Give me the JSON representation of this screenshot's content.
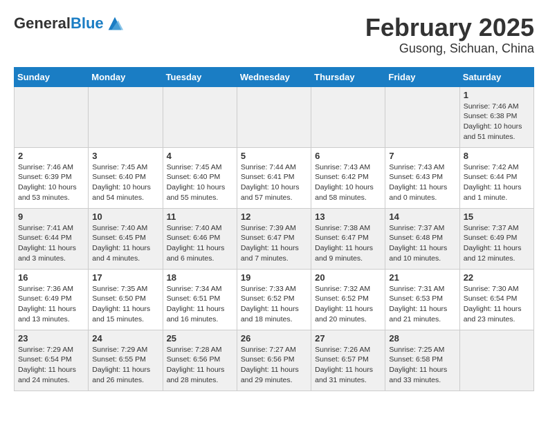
{
  "header": {
    "logo_general": "General",
    "logo_blue": "Blue",
    "title": "February 2025",
    "subtitle": "Gusong, Sichuan, China"
  },
  "days_of_week": [
    "Sunday",
    "Monday",
    "Tuesday",
    "Wednesday",
    "Thursday",
    "Friday",
    "Saturday"
  ],
  "weeks": [
    [
      {
        "day": "",
        "info": ""
      },
      {
        "day": "",
        "info": ""
      },
      {
        "day": "",
        "info": ""
      },
      {
        "day": "",
        "info": ""
      },
      {
        "day": "",
        "info": ""
      },
      {
        "day": "",
        "info": ""
      },
      {
        "day": "1",
        "info": "Sunrise: 7:46 AM\nSunset: 6:38 PM\nDaylight: 10 hours\nand 51 minutes."
      }
    ],
    [
      {
        "day": "2",
        "info": "Sunrise: 7:46 AM\nSunset: 6:39 PM\nDaylight: 10 hours\nand 53 minutes."
      },
      {
        "day": "3",
        "info": "Sunrise: 7:45 AM\nSunset: 6:40 PM\nDaylight: 10 hours\nand 54 minutes."
      },
      {
        "day": "4",
        "info": "Sunrise: 7:45 AM\nSunset: 6:40 PM\nDaylight: 10 hours\nand 55 minutes."
      },
      {
        "day": "5",
        "info": "Sunrise: 7:44 AM\nSunset: 6:41 PM\nDaylight: 10 hours\nand 57 minutes."
      },
      {
        "day": "6",
        "info": "Sunrise: 7:43 AM\nSunset: 6:42 PM\nDaylight: 10 hours\nand 58 minutes."
      },
      {
        "day": "7",
        "info": "Sunrise: 7:43 AM\nSunset: 6:43 PM\nDaylight: 11 hours\nand 0 minutes."
      },
      {
        "day": "8",
        "info": "Sunrise: 7:42 AM\nSunset: 6:44 PM\nDaylight: 11 hours\nand 1 minute."
      }
    ],
    [
      {
        "day": "9",
        "info": "Sunrise: 7:41 AM\nSunset: 6:44 PM\nDaylight: 11 hours\nand 3 minutes."
      },
      {
        "day": "10",
        "info": "Sunrise: 7:40 AM\nSunset: 6:45 PM\nDaylight: 11 hours\nand 4 minutes."
      },
      {
        "day": "11",
        "info": "Sunrise: 7:40 AM\nSunset: 6:46 PM\nDaylight: 11 hours\nand 6 minutes."
      },
      {
        "day": "12",
        "info": "Sunrise: 7:39 AM\nSunset: 6:47 PM\nDaylight: 11 hours\nand 7 minutes."
      },
      {
        "day": "13",
        "info": "Sunrise: 7:38 AM\nSunset: 6:47 PM\nDaylight: 11 hours\nand 9 minutes."
      },
      {
        "day": "14",
        "info": "Sunrise: 7:37 AM\nSunset: 6:48 PM\nDaylight: 11 hours\nand 10 minutes."
      },
      {
        "day": "15",
        "info": "Sunrise: 7:37 AM\nSunset: 6:49 PM\nDaylight: 11 hours\nand 12 minutes."
      }
    ],
    [
      {
        "day": "16",
        "info": "Sunrise: 7:36 AM\nSunset: 6:49 PM\nDaylight: 11 hours\nand 13 minutes."
      },
      {
        "day": "17",
        "info": "Sunrise: 7:35 AM\nSunset: 6:50 PM\nDaylight: 11 hours\nand 15 minutes."
      },
      {
        "day": "18",
        "info": "Sunrise: 7:34 AM\nSunset: 6:51 PM\nDaylight: 11 hours\nand 16 minutes."
      },
      {
        "day": "19",
        "info": "Sunrise: 7:33 AM\nSunset: 6:52 PM\nDaylight: 11 hours\nand 18 minutes."
      },
      {
        "day": "20",
        "info": "Sunrise: 7:32 AM\nSunset: 6:52 PM\nDaylight: 11 hours\nand 20 minutes."
      },
      {
        "day": "21",
        "info": "Sunrise: 7:31 AM\nSunset: 6:53 PM\nDaylight: 11 hours\nand 21 minutes."
      },
      {
        "day": "22",
        "info": "Sunrise: 7:30 AM\nSunset: 6:54 PM\nDaylight: 11 hours\nand 23 minutes."
      }
    ],
    [
      {
        "day": "23",
        "info": "Sunrise: 7:29 AM\nSunset: 6:54 PM\nDaylight: 11 hours\nand 24 minutes."
      },
      {
        "day": "24",
        "info": "Sunrise: 7:29 AM\nSunset: 6:55 PM\nDaylight: 11 hours\nand 26 minutes."
      },
      {
        "day": "25",
        "info": "Sunrise: 7:28 AM\nSunset: 6:56 PM\nDaylight: 11 hours\nand 28 minutes."
      },
      {
        "day": "26",
        "info": "Sunrise: 7:27 AM\nSunset: 6:56 PM\nDaylight: 11 hours\nand 29 minutes."
      },
      {
        "day": "27",
        "info": "Sunrise: 7:26 AM\nSunset: 6:57 PM\nDaylight: 11 hours\nand 31 minutes."
      },
      {
        "day": "28",
        "info": "Sunrise: 7:25 AM\nSunset: 6:58 PM\nDaylight: 11 hours\nand 33 minutes."
      },
      {
        "day": "",
        "info": ""
      }
    ]
  ]
}
